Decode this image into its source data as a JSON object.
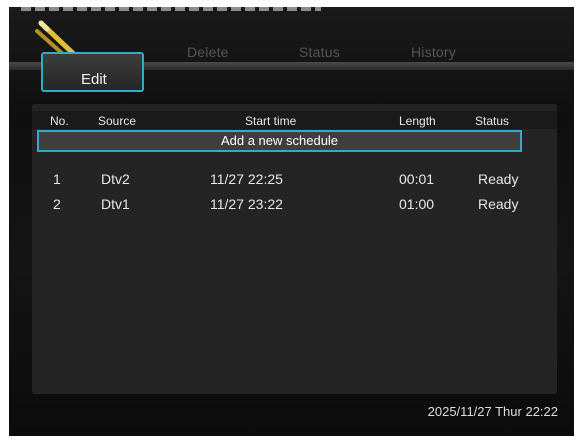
{
  "tabs": {
    "edit": "Edit",
    "delete": "Delete",
    "status": "Status",
    "history": "History"
  },
  "table": {
    "columns": [
      "No.",
      "Source",
      "Start time",
      "Length",
      "Status"
    ],
    "add_new": "Add a new schedule",
    "rows": [
      {
        "no": "1",
        "source": "Dtv2",
        "start": "11/27 22:25",
        "length": "00:01",
        "status": "Ready"
      },
      {
        "no": "2",
        "source": "Dtv1",
        "start": "11/27 23:22",
        "length": "01:00",
        "status": "Ready"
      }
    ]
  },
  "clock": "2025/11/27 Thur 22:22",
  "colors": {
    "highlight": "#38a8c8",
    "background": "#121212",
    "pencil": "#d8b23a"
  },
  "icons": {
    "menu_icon": "pencil-icon"
  }
}
